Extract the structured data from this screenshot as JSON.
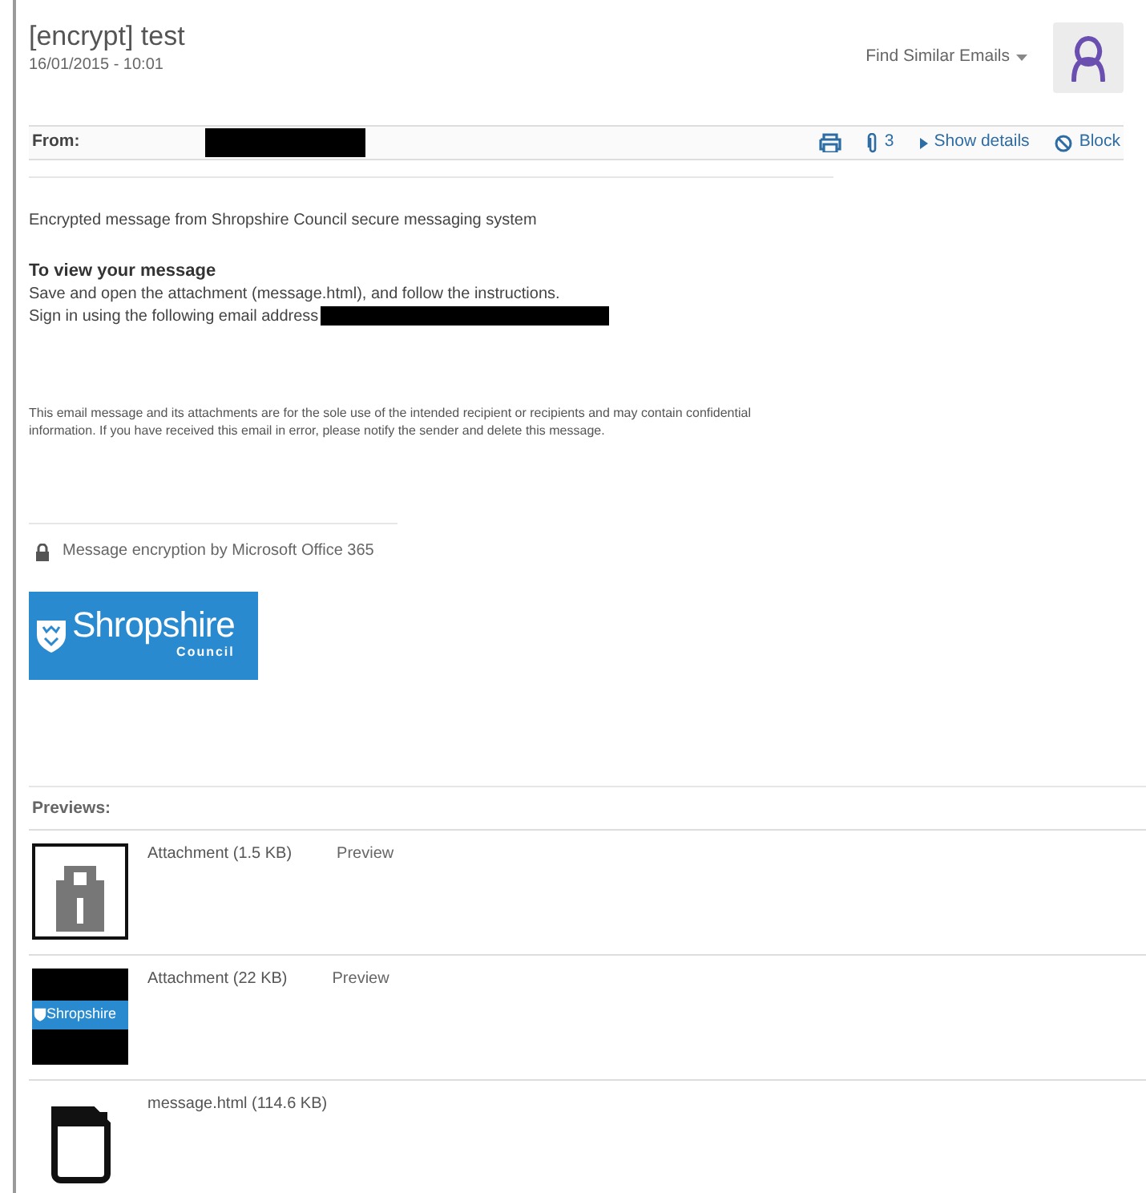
{
  "subject": "[encrypt] test",
  "date": "16/01/2015 - 10:01",
  "find_similar": "Find Similar Emails",
  "header": {
    "from_label": "From:",
    "from_redacted": true,
    "attachment_count": "3",
    "show_details": "Show details",
    "block": "Block"
  },
  "body": {
    "intro": "Encrypted message from Shropshire Council secure messaging system",
    "heading": "To view your message",
    "line_1": "Save and open the attachment (message.html), and follow the instructions.",
    "line_2": "Sign in using the following email address",
    "line_2_redacted": true,
    "disclaimer": "This email message and its attachments are for the sole use of the intended recipient or recipients and may contain confidential information. If you have received this email in error, please notify the sender and delete this message.",
    "encryption_note": "Message encryption by Microsoft Office 365",
    "logo": {
      "name": "Shropshire",
      "sub": "Council"
    }
  },
  "previews": {
    "title": "Previews:",
    "items": [
      {
        "kind": "lock",
        "name": "Attachment (1.5 KB)",
        "action": "Preview"
      },
      {
        "kind": "logo",
        "name": "Attachment (22 KB)",
        "action": "Preview",
        "thumb_text": "Shropshire"
      },
      {
        "kind": "file",
        "name": "message.html (114.6 KB)"
      }
    ]
  }
}
